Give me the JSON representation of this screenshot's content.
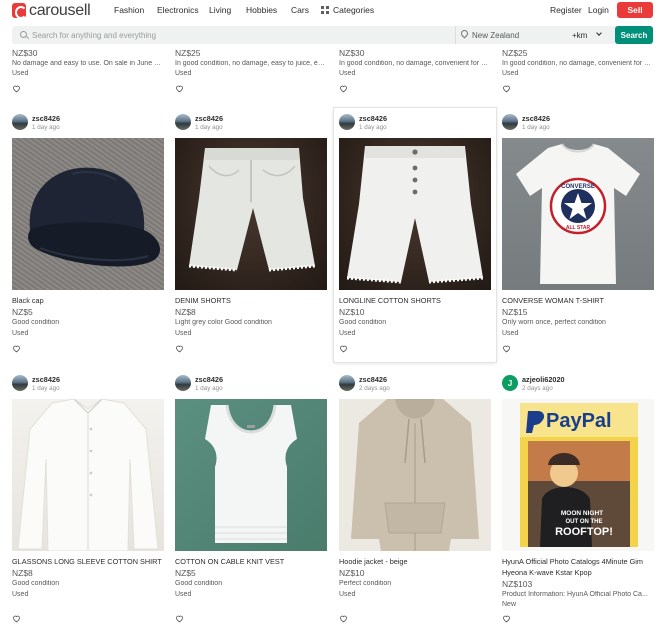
{
  "nav": {
    "logo": "carousell",
    "links": [
      "Fashion",
      "Electronics",
      "Living",
      "Hobbies",
      "Cars"
    ],
    "categories": "Categories",
    "register": "Register",
    "login": "Login",
    "sell": "Sell"
  },
  "search": {
    "placeholder": "Search for anything and everything",
    "location": "New Zealand",
    "distance": "+km",
    "button": "Search"
  },
  "top_row": [
    {
      "price": "NZ$30",
      "desc": "No damage and easy to use. On sale in June Pr...",
      "cond": "Used"
    },
    {
      "price": "NZ$25",
      "desc": "In good condition, no damage, easy to juice, ev...",
      "cond": "Used"
    },
    {
      "price": "NZ$30",
      "desc": "In good condition, no damage, convenient for c...",
      "cond": "Used"
    },
    {
      "price": "NZ$25",
      "desc": "In good condition, no damage, convenient for c...",
      "cond": "Used"
    }
  ],
  "listings": [
    {
      "seller": "zsc8426",
      "time": "1 day ago",
      "title": "Black cap",
      "price": "NZ$5",
      "desc": "Good condition",
      "cond": "Used",
      "photo": "black-cap"
    },
    {
      "seller": "zsc8426",
      "time": "1 day ago",
      "title": "DENIM SHORTS",
      "price": "NZ$8",
      "desc": "Light grey color Good condition",
      "cond": "Used",
      "photo": "denim-shorts"
    },
    {
      "seller": "zsc8426",
      "time": "1 day ago",
      "title": "LONGLINE COTTON SHORTS",
      "price": "NZ$10",
      "desc": "Good condition",
      "cond": "Used",
      "photo": "cotton-shorts"
    },
    {
      "seller": "zsc8426",
      "time": "1 day ago",
      "title": "CONVERSE WOMAN T-SHIRT",
      "price": "NZ$15",
      "desc": "Only worn once, perfect condition",
      "cond": "Used",
      "photo": "converse-tshirt",
      "print": [
        "CONVERSE",
        "ALL STAR"
      ]
    },
    {
      "seller": "zsc8426",
      "time": "1 day ago",
      "title": "GLASSONS LONG SLEEVE COTTON SHIRT",
      "price": "NZ$8",
      "desc": "Good condition",
      "cond": "Used",
      "photo": "white-shirt"
    },
    {
      "seller": "zsc8426",
      "time": "1 day ago",
      "title": "COTTON ON CABLE KNIT VEST",
      "price": "NZ$5",
      "desc": "Good condition",
      "cond": "Used",
      "photo": "knit-vest"
    },
    {
      "seller": "zsc8426",
      "time": "2 days ago",
      "title": "Hoodie jacket - beige",
      "price": "NZ$10",
      "desc": "Perfect condition",
      "cond": "Used",
      "photo": "beige-hoodie"
    },
    {
      "seller": "azjeoli62020",
      "avatar_letter": "J",
      "time": "2 days ago",
      "title": "HyunA Official Photo Catalogs 4Minute Gim",
      "title2": "Hyeona K-wave Kstar Kpop",
      "price": "NZ$103",
      "desc": "Product Information:    HyunA Official Photo Ca...",
      "cond": "New",
      "photo": "paypal-catalog",
      "print": [
        "PayPal",
        "MOON NIGHT",
        "OUT ON THE",
        "ROOFTOP!"
      ]
    }
  ],
  "colors": {
    "brand": "#ea3a3a",
    "search_button": "#008f79",
    "avatar_green": "#0a9e62"
  }
}
